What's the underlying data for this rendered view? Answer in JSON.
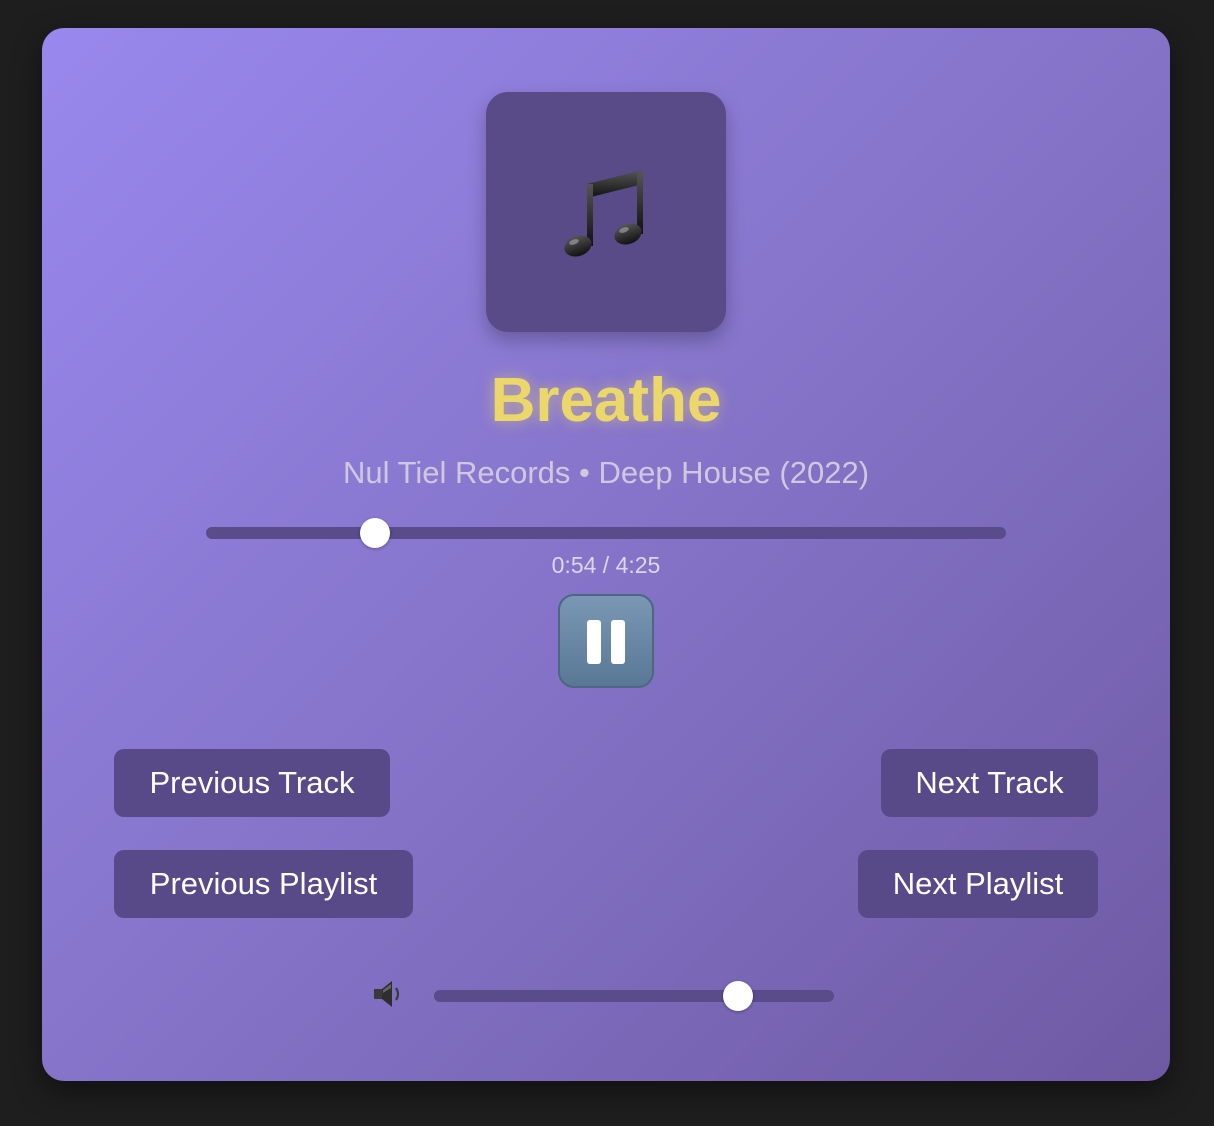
{
  "track": {
    "title": "Breathe",
    "subtitle": "Nul Tiel Records • Deep House (2022)"
  },
  "playback": {
    "time_display": "0:54 / 4:25",
    "progress_fraction": 0.2117,
    "state": "playing"
  },
  "controls": {
    "previous_track": "Previous Track",
    "next_track": "Next Track",
    "previous_playlist": "Previous Playlist",
    "next_playlist": "Next Playlist"
  },
  "volume": {
    "level_fraction": 0.76
  },
  "icons": {
    "album_art": "music-notes-icon",
    "play_pause": "pause-icon",
    "volume": "speaker-icon"
  },
  "colors": {
    "title": "#ecd86a",
    "button_bg": "#584a88",
    "track_bg": "#5a4b8b"
  }
}
